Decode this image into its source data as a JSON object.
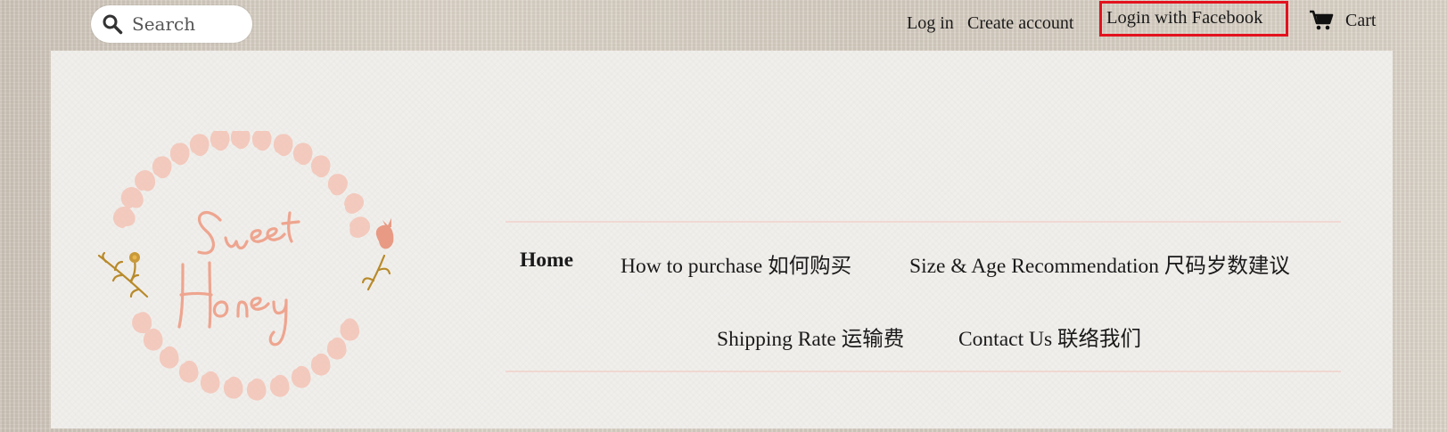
{
  "header": {
    "search": {
      "placeholder": "Search",
      "icon": "search-icon"
    },
    "links": {
      "login": "Log in",
      "create_account": "Create account",
      "facebook_login": "Login with Facebook",
      "cart": "Cart"
    },
    "highlight_color": "#e3121e"
  },
  "logo": {
    "text_line1": "Sweet",
    "text_line2": "Honey",
    "color": "#eea58f"
  },
  "nav": {
    "items": [
      {
        "label": "Home",
        "active": true
      },
      {
        "label": "How to purchase 如何购买",
        "active": false
      },
      {
        "label": "Size & Age Recommendation 尺码岁数建议",
        "active": false
      },
      {
        "label": "Shipping Rate 运输费",
        "active": false
      },
      {
        "label": "Contact Us 联络我们",
        "active": false
      }
    ],
    "divider_color": "#f0d8d2"
  }
}
